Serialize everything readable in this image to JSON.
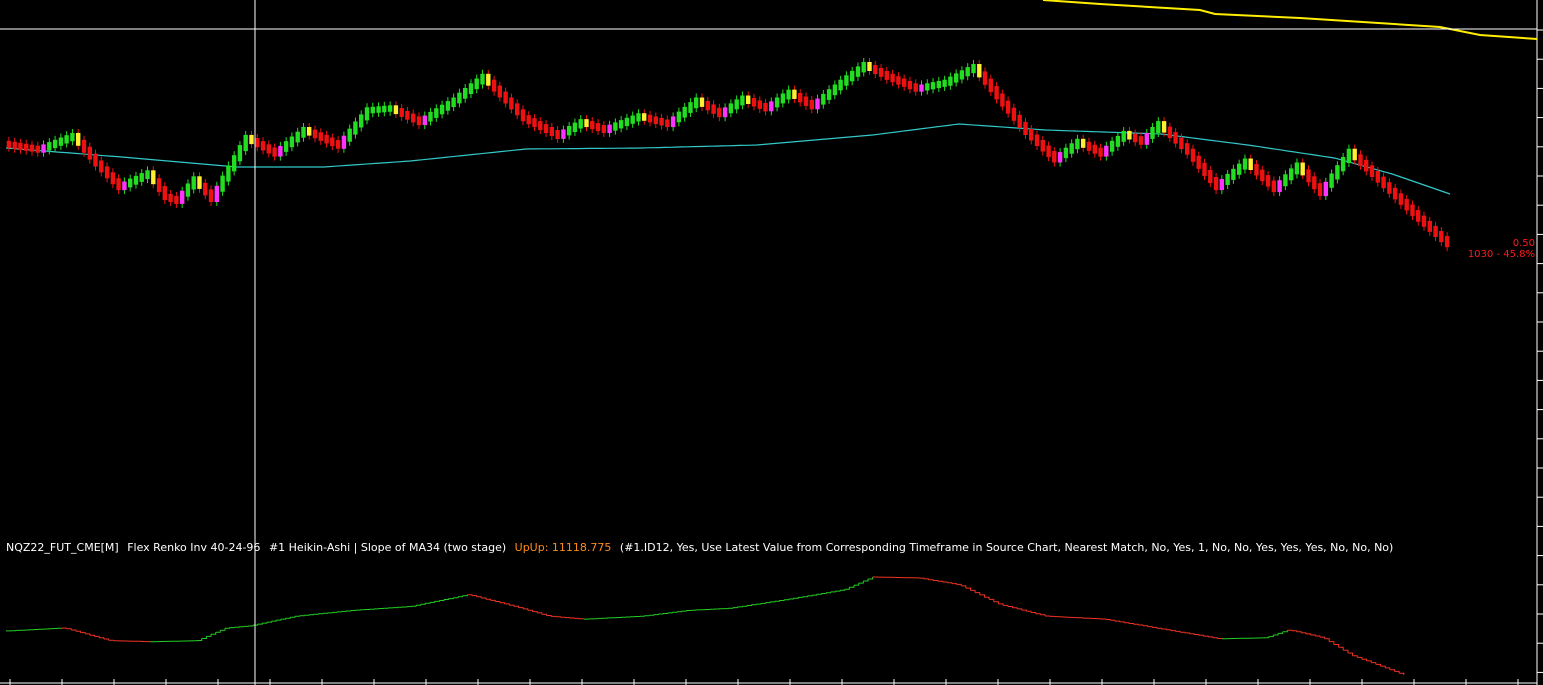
{
  "colors": {
    "background": "#000000",
    "up_bar": "#22dd22",
    "down_bar": "#ee1111",
    "up_alt": "#ff33ff",
    "down_alt": "#ffee33",
    "ma_line": "#33c8c8",
    "yellow_line": "#ffee00",
    "slope_up": "#22cc22",
    "slope_down": "#ee3322",
    "crosshair": "#ffffff",
    "axis": "#ffffff",
    "price_text": "#ff1a1a",
    "upup_text": "#ff8c1a"
  },
  "study_label": {
    "symbol": "NQZ22_FUT_CME[M]",
    "bar_type": "Flex Renko Inv 40-24-96",
    "study": "#1 Heikin-Ashi | Slope of MA34 (two stage)",
    "upup_label": "UpUp: 11118.775",
    "params": "(#1.ID12, Yes, Use Latest Value from Corresponding Timeframe in Source Chart, Nearest Match, No, Yes, 1, No, No, Yes, Yes, Yes, No, No, No)"
  },
  "price_box": {
    "line1": "0.50",
    "line2": "1030 - 45.8%"
  },
  "chart_data": [
    {
      "type": "line",
      "name": "price",
      "x": [
        0,
        6,
        12,
        16,
        20,
        25,
        28,
        30,
        33,
        36,
        42,
        47,
        52,
        58,
        63,
        67,
        72,
        78,
        83,
        90,
        96,
        100,
        104,
        110,
        115,
        120,
        124,
        128,
        132,
        136,
        140,
        145,
        149,
        153,
        158,
        163,
        168,
        172,
        177,
        182,
        186,
        190,
        194,
        197,
        200,
        205,
        210,
        215,
        220,
        224,
        228,
        233,
        239,
        245,
        250
      ],
      "values": [
        0.6,
        0.57,
        0.64,
        0.5,
        0.38,
        0.45,
        0.33,
        0.31,
        0.42,
        0.32,
        0.63,
        0.55,
        0.67,
        0.59,
        0.77,
        0.78,
        0.71,
        0.82,
        0.94,
        0.73,
        0.64,
        0.71,
        0.67,
        0.74,
        0.7,
        0.82,
        0.75,
        0.83,
        0.78,
        0.86,
        0.79,
        0.91,
        1.0,
        0.94,
        0.88,
        0.91,
        0.99,
        0.84,
        0.66,
        0.52,
        0.61,
        0.55,
        0.65,
        0.61,
        0.7,
        0.56,
        0.38,
        0.51,
        0.37,
        0.49,
        0.35,
        0.56,
        0.39,
        0.22,
        0.09
      ]
    },
    {
      "type": "line",
      "name": "MA34",
      "x": [
        0,
        20,
        40,
        55,
        70,
        90,
        110,
        130,
        150,
        165,
        180,
        200,
        215,
        230,
        240,
        250
      ],
      "values": [
        0.76,
        0.67,
        0.57,
        0.57,
        0.63,
        0.75,
        0.76,
        0.79,
        0.89,
        1.0,
        0.94,
        0.9,
        0.79,
        0.66,
        0.5,
        0.3
      ]
    },
    {
      "type": "line",
      "name": "Slope of MA34",
      "x": [
        0,
        10,
        18,
        25,
        33,
        38,
        42,
        50,
        60,
        70,
        80,
        88,
        94,
        100,
        110,
        118,
        125,
        135,
        145,
        150,
        158,
        165,
        172,
        180,
        190,
        200,
        210,
        218,
        222,
        228,
        233,
        238,
        242
      ],
      "values": [
        0.45,
        0.48,
        0.35,
        0.34,
        0.35,
        0.48,
        0.5,
        0.6,
        0.66,
        0.7,
        0.82,
        0.7,
        0.6,
        0.57,
        0.6,
        0.66,
        0.68,
        0.77,
        0.87,
        1.0,
        0.99,
        0.92,
        0.72,
        0.6,
        0.57,
        0.47,
        0.37,
        0.38,
        0.46,
        0.38,
        0.2,
        0.09,
        0.0
      ]
    }
  ]
}
